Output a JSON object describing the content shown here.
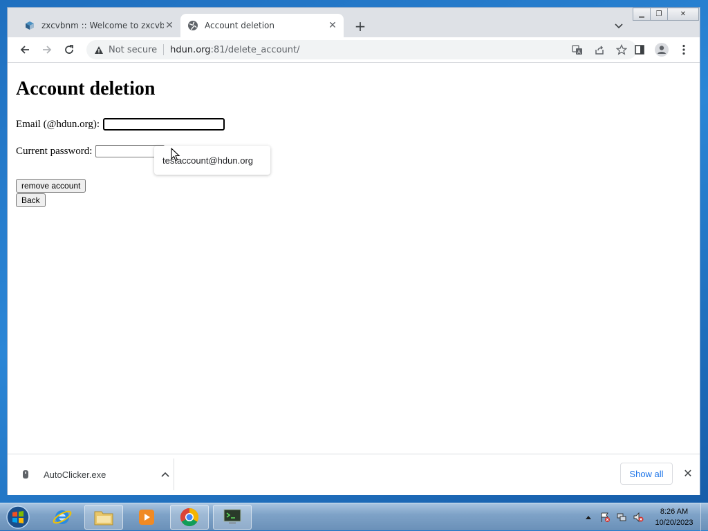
{
  "browser": {
    "tabs": [
      {
        "title": "zxcvbnm :: Welcome to zxcvbnm",
        "active": false,
        "icon": "zxcvbnm-favicon"
      },
      {
        "title": "Account deletion",
        "active": true,
        "icon": "globe-icon"
      }
    ],
    "address": {
      "security_label": "Not secure",
      "host": "hdun.org",
      "path": ":81/delete_account/"
    }
  },
  "page": {
    "heading": "Account deletion",
    "email_label": "Email (@hdun.org):",
    "email_value": "",
    "password_label": "Current password:",
    "password_value": "",
    "remove_button": "remove account",
    "back_button": "Back",
    "autofill_suggestion": "testaccount@hdun.org"
  },
  "downloads": {
    "file_name": "AutoClicker.exe",
    "show_all": "Show all"
  },
  "taskbar": {
    "time": "8:26 AM",
    "date": "10/20/2023"
  },
  "colors": {
    "accent_blue": "#1a73e8",
    "tabstrip": "#dee1e6",
    "omnibox": "#f1f3f4"
  }
}
